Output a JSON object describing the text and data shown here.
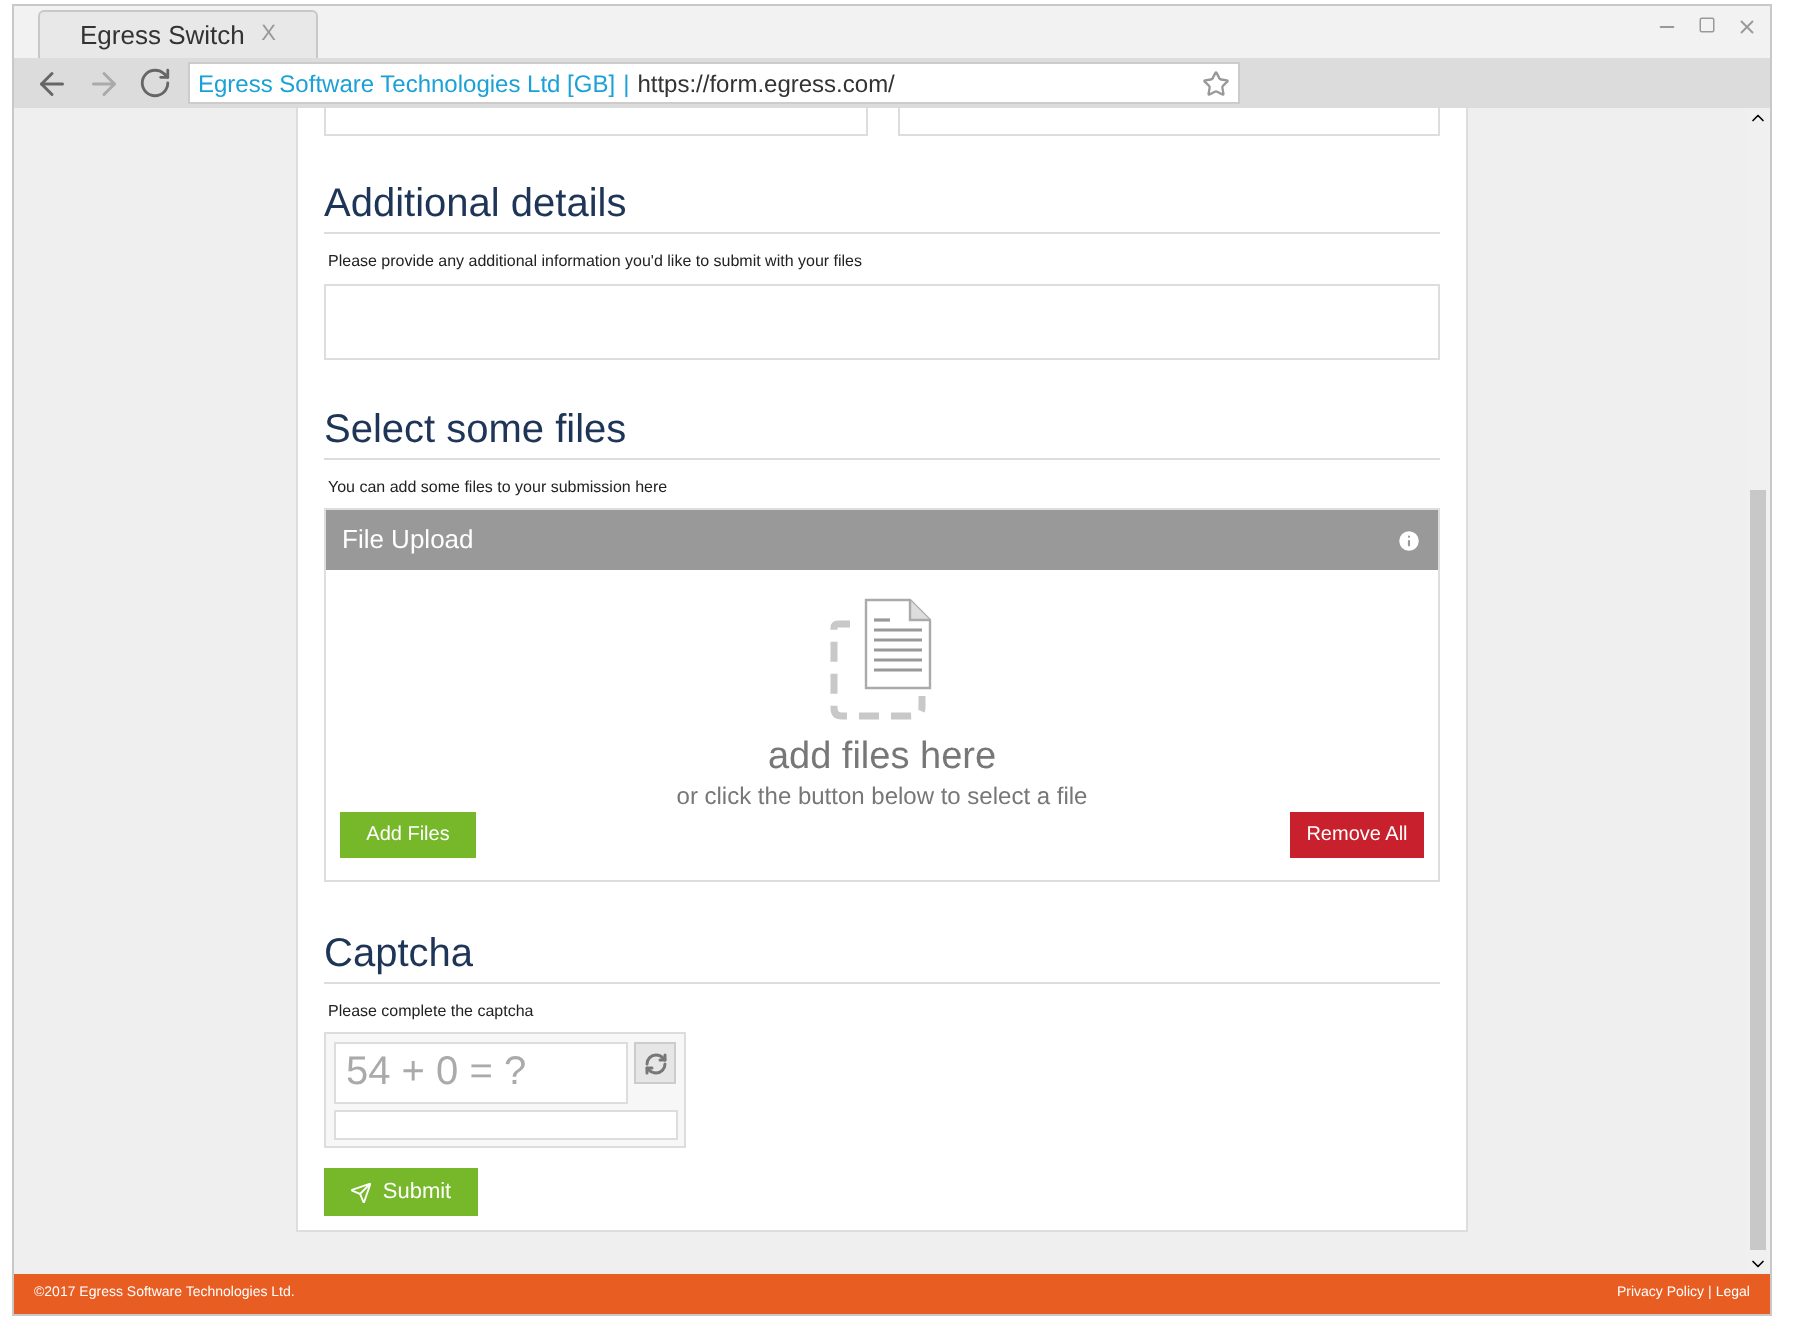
{
  "browser": {
    "tab_title": "Egress Switch",
    "tab_close": "X",
    "site_identity": "Egress Software Technologies Ltd [GB]",
    "separator": "|",
    "url": "https://form.egress.com/"
  },
  "additional": {
    "heading": "Additional details",
    "hint": "Please provide any additional information you'd like to submit with your files"
  },
  "files": {
    "heading": "Select some files",
    "hint": "You can add some files to your submission here",
    "upload_title": "File Upload",
    "drop_title": "add files here",
    "drop_hint": "or click the button below to select a file",
    "add_button": "Add Files",
    "remove_button": "Remove All"
  },
  "captcha": {
    "heading": "Captcha",
    "hint": "Please complete the captcha",
    "question": "54 + 0 = ?"
  },
  "submit": "Submit",
  "footer": {
    "copyright": "©2017 Egress Software Technologies Ltd.",
    "links": [
      "Privacy Policy",
      "Legal"
    ],
    "separator": "|"
  }
}
